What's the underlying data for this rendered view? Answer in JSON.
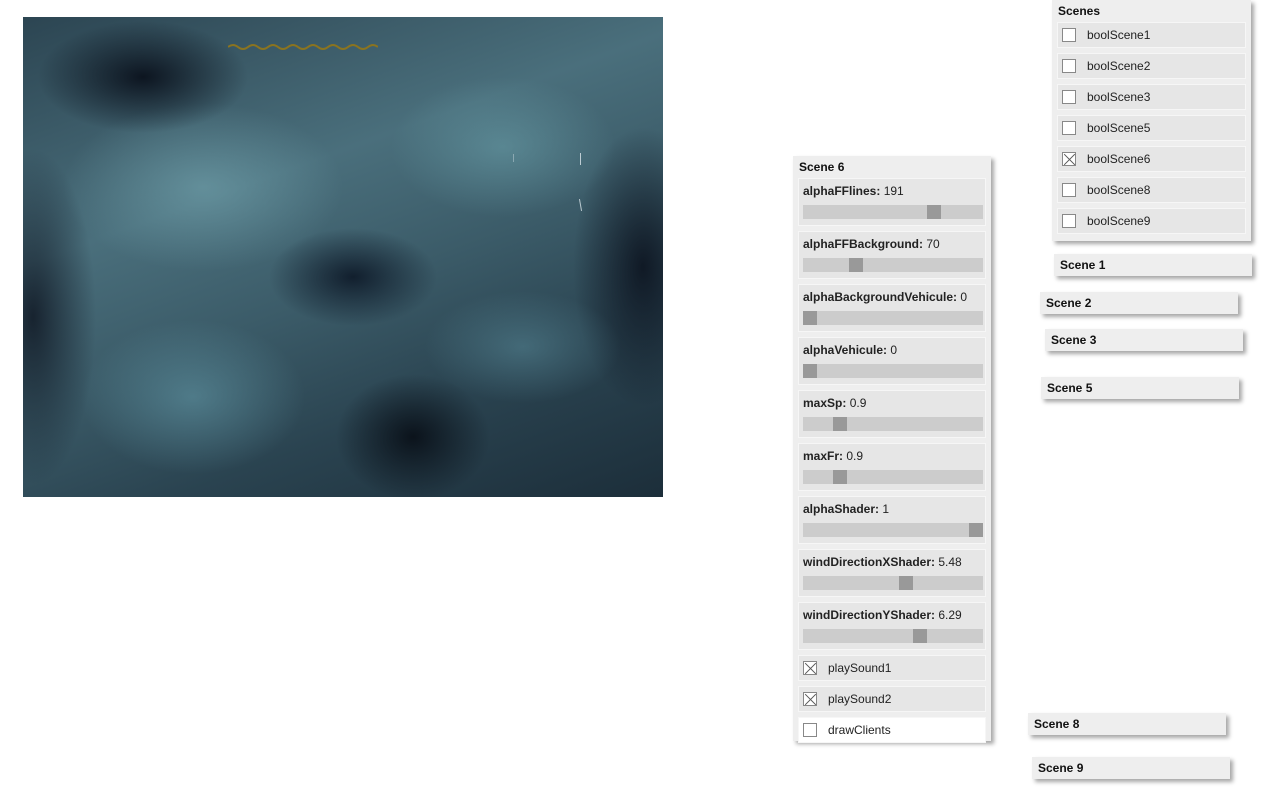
{
  "scene6_panel": {
    "title": "Scene 6",
    "sliders": [
      {
        "name": "alphaFFlines",
        "value": "191",
        "fraction": 0.749
      },
      {
        "name": "alphaFFBackground",
        "value": "70",
        "fraction": 0.275
      },
      {
        "name": "alphaBackgroundVehicule",
        "value": "0",
        "fraction": 0.0
      },
      {
        "name": "alphaVehicule",
        "value": "0",
        "fraction": 0.0
      },
      {
        "name": "maxSp",
        "value": "0.9",
        "fraction": 0.18
      },
      {
        "name": "maxFr",
        "value": "0.9",
        "fraction": 0.18
      },
      {
        "name": "alphaShader",
        "value": "1",
        "fraction": 1.0
      },
      {
        "name": "windDirectionXShader",
        "value": "5.48",
        "fraction": 0.58
      },
      {
        "name": "windDirectionYShader",
        "value": "6.29",
        "fraction": 0.66
      }
    ],
    "checkboxes": [
      {
        "label": "playSound1",
        "checked": true
      },
      {
        "label": "playSound2",
        "checked": true
      },
      {
        "label": "drawClients",
        "checked": false
      }
    ]
  },
  "scenes_panel": {
    "title": "Scenes",
    "checkboxes": [
      {
        "label": "boolScene1",
        "checked": false
      },
      {
        "label": "boolScene2",
        "checked": false
      },
      {
        "label": "boolScene3",
        "checked": false
      },
      {
        "label": "boolScene5",
        "checked": false
      },
      {
        "label": "boolScene6",
        "checked": true
      },
      {
        "label": "boolScene8",
        "checked": false
      },
      {
        "label": "boolScene9",
        "checked": false
      }
    ]
  },
  "collapsed_panels": {
    "scene1": "Scene 1",
    "scene2": "Scene 2",
    "scene3": "Scene 3",
    "scene5": "Scene 5",
    "scene8": "Scene 8",
    "scene9": "Scene 9"
  },
  "colors": {
    "panel_bg": "#eeeeee",
    "slider_track": "#cccccc",
    "slider_thumb": "#999999"
  }
}
